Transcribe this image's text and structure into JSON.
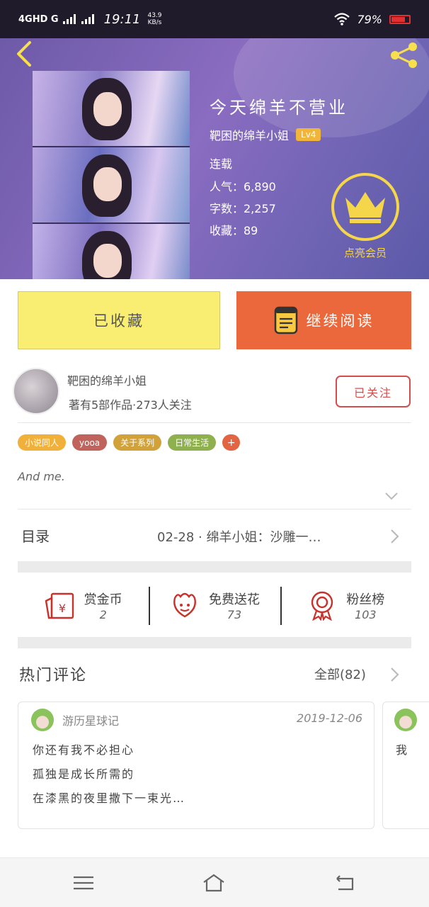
{
  "status_bar": {
    "network": "4GHD G",
    "time": "19:11",
    "speed_value": "43.9",
    "speed_unit": "KB/s",
    "battery": "79%"
  },
  "book": {
    "title": "今天绵羊不营业",
    "author": "靶困的绵羊小姐",
    "level_badge": "Lv4",
    "status": "连载",
    "popularity": "人气：6,890",
    "word_count": "字数：2,257",
    "favorites": "收藏：89",
    "vip_label": "点亮会员"
  },
  "actions": {
    "favorite_label": "已收藏",
    "read_label": "继续阅读"
  },
  "author_info": {
    "name": "靶困的绵羊小姐",
    "subtitle": "著有5部作品·273人关注",
    "follow_label": "已关注"
  },
  "tags": [
    {
      "label": "小说同人",
      "color": "#f0b03a"
    },
    {
      "label": "yooa",
      "color": "#c0635c"
    },
    {
      "label": "关于系列",
      "color": "#d1a23a"
    },
    {
      "label": "日常生活",
      "color": "#8fb04f"
    }
  ],
  "tag_add": "+",
  "description": "And me.",
  "toc": {
    "label": "目录",
    "latest": "02-28 · 绵羊小姐：沙雕一…"
  },
  "stats": [
    {
      "label": "赏金币",
      "value": "2",
      "icon": "red-envelope-icon"
    },
    {
      "label": "免费送花",
      "value": "73",
      "icon": "flower-icon"
    },
    {
      "label": "粉丝榜",
      "value": "103",
      "icon": "medal-icon"
    }
  ],
  "comments": {
    "title": "热门评论",
    "all_label": "全部(82)",
    "items": [
      {
        "user": "游历星球记",
        "date": "2019-12-06",
        "lines": [
          "你还有我不必担心",
          "孤独是成长所需的",
          "在漆黑的夜里撒下一束光…"
        ]
      },
      {
        "user": "",
        "date": "",
        "lines": [
          "我"
        ]
      }
    ]
  },
  "colors": {
    "accent_orange": "#ea683b",
    "favorite_yellow": "#faee72",
    "follow_red": "#d54d4d",
    "vip_gold": "#f5d64a"
  }
}
